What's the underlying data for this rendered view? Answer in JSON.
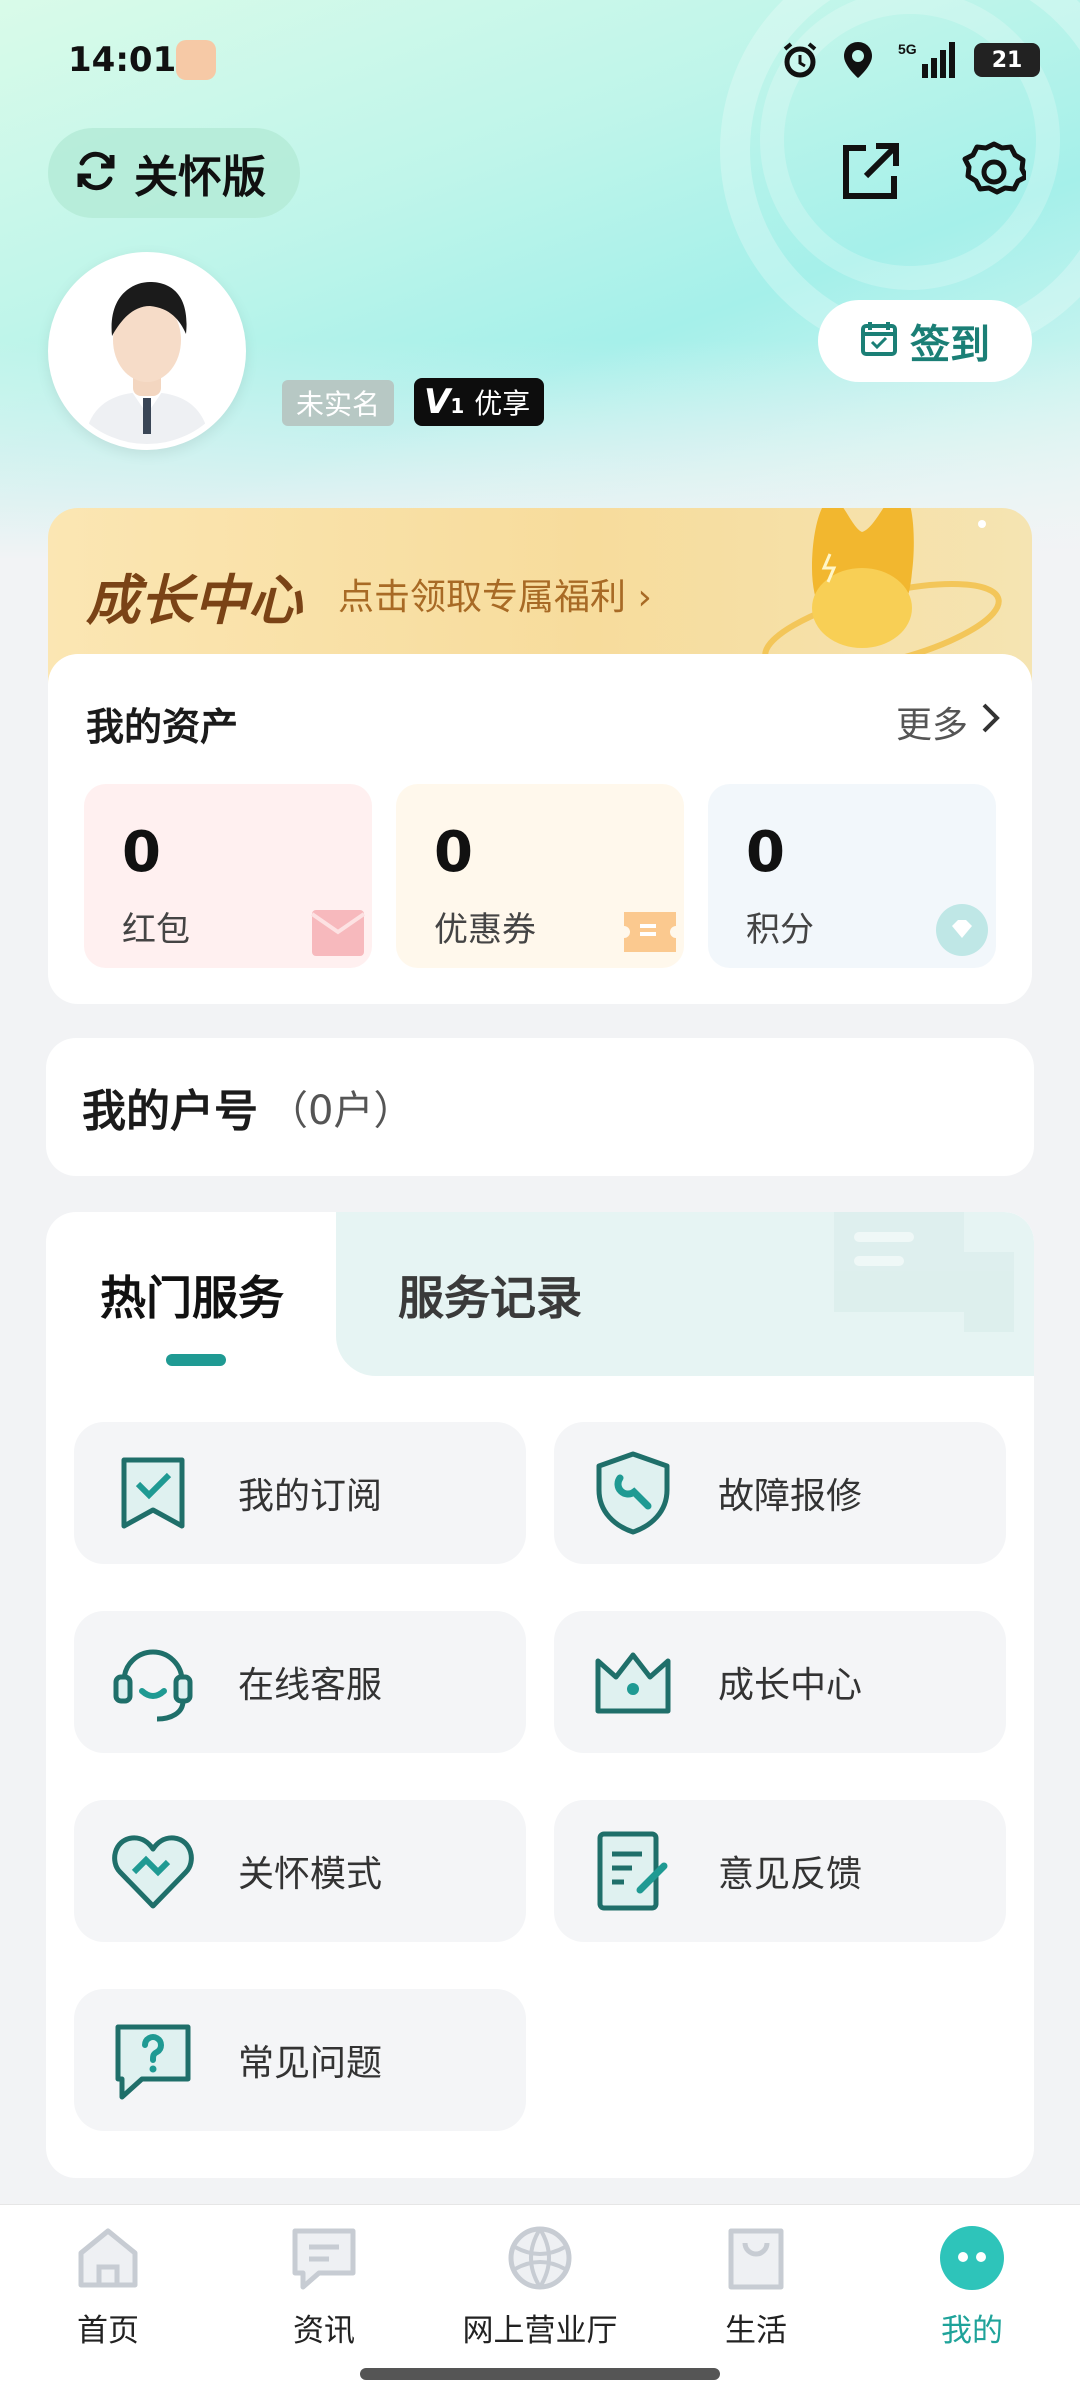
{
  "status_bar": {
    "time": "14:01",
    "network": "5G",
    "battery": "21"
  },
  "header": {
    "care_mode_label": "关怀版"
  },
  "profile": {
    "badge_unverified": "未实名",
    "vip_level": "1",
    "vip_label": "优享",
    "checkin_label": "签到"
  },
  "growth": {
    "title": "成长中心",
    "subtitle": "点击领取专属福利 ›"
  },
  "assets": {
    "title": "我的资产",
    "more_label": "更多",
    "items": [
      {
        "value": "0",
        "label": "红包"
      },
      {
        "value": "0",
        "label": "优惠券"
      },
      {
        "value": "0",
        "label": "积分"
      }
    ]
  },
  "account": {
    "title": "我的户号",
    "count": "（0户）"
  },
  "services": {
    "tabs": [
      {
        "label": "热门服务"
      },
      {
        "label": "服务记录"
      }
    ],
    "items": [
      {
        "label": "我的订阅",
        "icon": "subscription-icon"
      },
      {
        "label": "故障报修",
        "icon": "repair-icon"
      },
      {
        "label": "在线客服",
        "icon": "headset-icon"
      },
      {
        "label": "成长中心",
        "icon": "crown-icon"
      },
      {
        "label": "关怀模式",
        "icon": "heart-icon"
      },
      {
        "label": "意见反馈",
        "icon": "feedback-icon"
      },
      {
        "label": "常见问题",
        "icon": "faq-icon"
      }
    ]
  },
  "bottom_nav": {
    "items": [
      {
        "label": "首页",
        "icon": "home-icon"
      },
      {
        "label": "资讯",
        "icon": "news-icon"
      },
      {
        "label": "网上营业厅",
        "icon": "globe-icon"
      },
      {
        "label": "生活",
        "icon": "bag-icon"
      },
      {
        "label": "我的",
        "icon": "profile-icon"
      }
    ],
    "active_index": 4
  },
  "colors": {
    "accent": "#1f9a93",
    "nav_active": "#1fa39a"
  }
}
